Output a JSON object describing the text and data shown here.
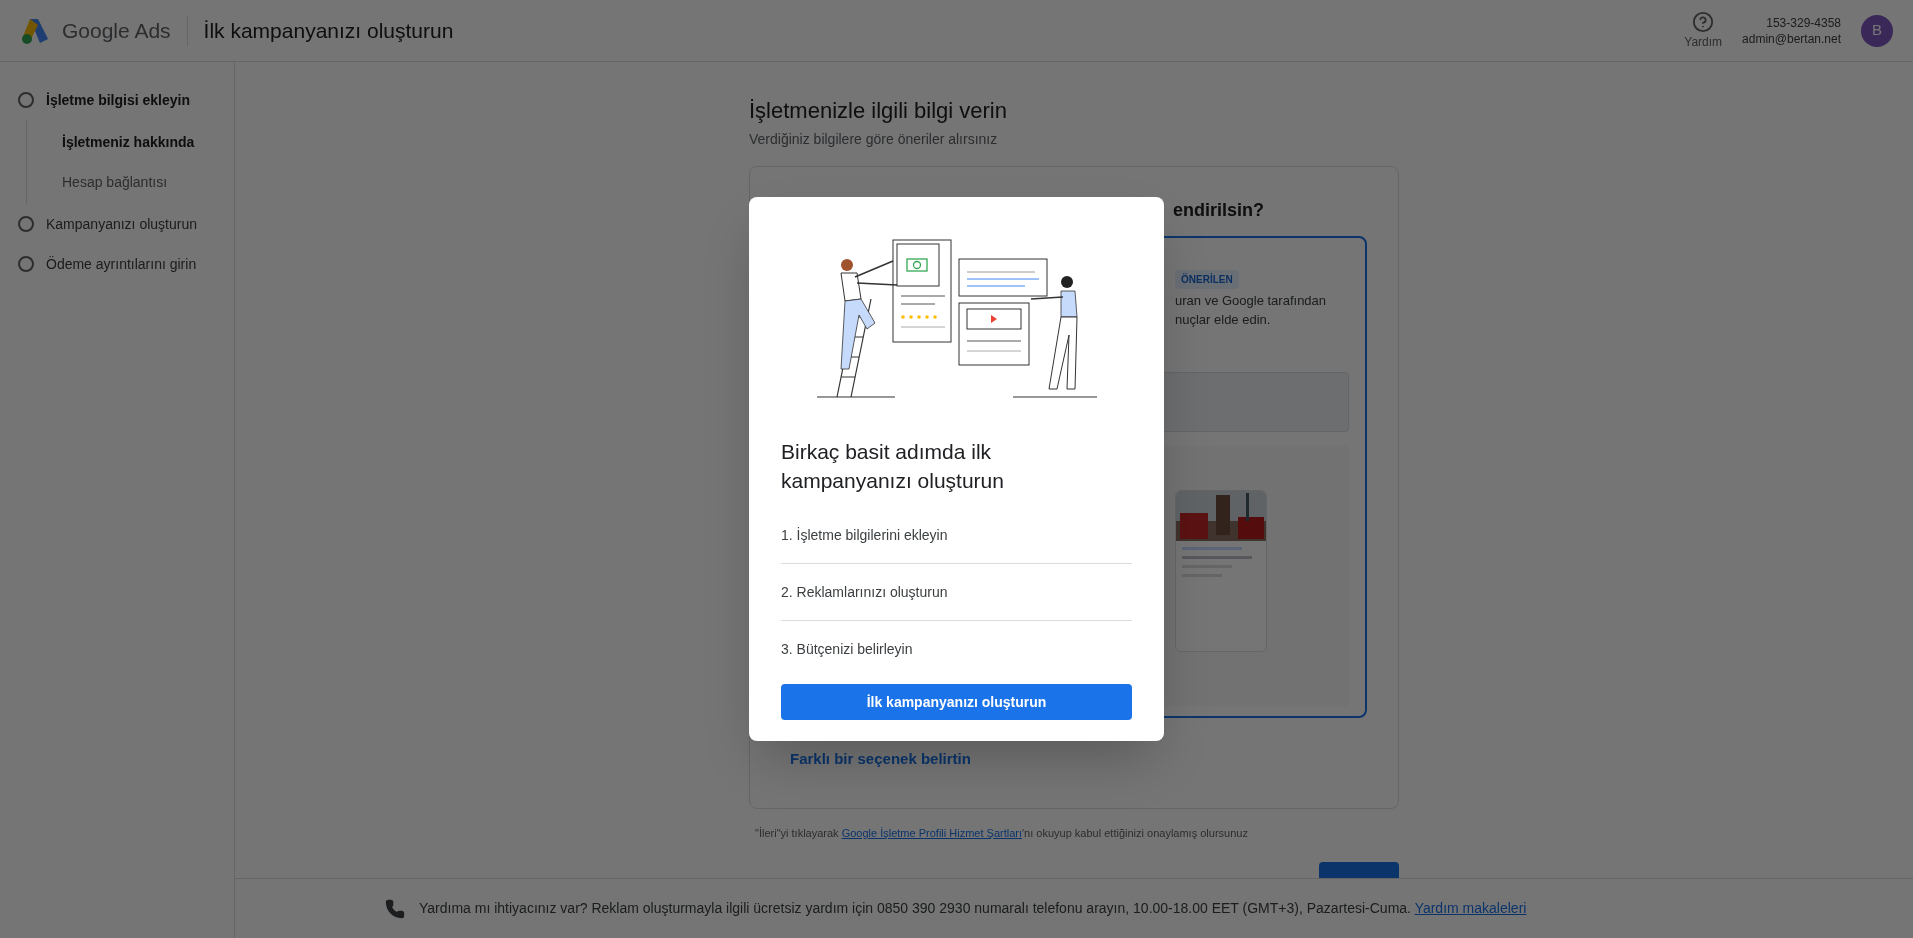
{
  "header": {
    "product": "Google Ads",
    "title": "İlk kampanyanızı oluşturun",
    "help": "Yardım",
    "account_id": "153-329-4358",
    "email": "admin@bertan.net",
    "avatar": "B"
  },
  "sidebar": {
    "steps": [
      {
        "label": "İşletme bilgisi ekleyin",
        "active": true,
        "children": [
          {
            "label": "İşletmeniz hakkında",
            "selected": true
          },
          {
            "label": "Hesap bağlantısı",
            "selected": false
          }
        ]
      },
      {
        "label": "Kampanyanızı oluşturun",
        "active": false
      },
      {
        "label": "Ödeme ayrıntılarını girin",
        "active": false
      }
    ]
  },
  "main": {
    "title": "İşletmenizle ilgili bilgi verin",
    "subtitle": "Verdiğiniz bilgilere göre öneriler alırsınız",
    "card": {
      "question": "endirilsin?",
      "option": {
        "selected": true,
        "badge": "ÖNERİLEN",
        "description": [
          "uran ve Google tarafından",
          "nuçlar elde edin."
        ]
      },
      "other_link": "Farklı bir seçenek belirtin"
    },
    "terms": {
      "before": "\"İleri\"yi tıklayarak ",
      "link": "Google İşletme Profili Hizmet Şartları",
      "after": "'nı okuyup kabul ettiğinizi onaylamış olursunuz"
    }
  },
  "footer": {
    "text": "Yardıma mı ihtiyacınız var? Reklam oluşturmayla ilgili ücretsiz yardım için 0850 390 2930 numaralı telefonu arayın, 10.00-18.00 EET (GMT+3), Pazartesi-Cuma.",
    "link": "Yardım makaleleri"
  },
  "modal": {
    "title": "Birkaç basit adımda ilk kampanyanızı oluşturun",
    "steps": [
      "1. İşletme bilgilerini ekleyin",
      "2. Reklamlarınızı oluşturun",
      "3. Bütçenizi belirleyin"
    ],
    "button": "İlk kampanyanızı oluşturun"
  }
}
